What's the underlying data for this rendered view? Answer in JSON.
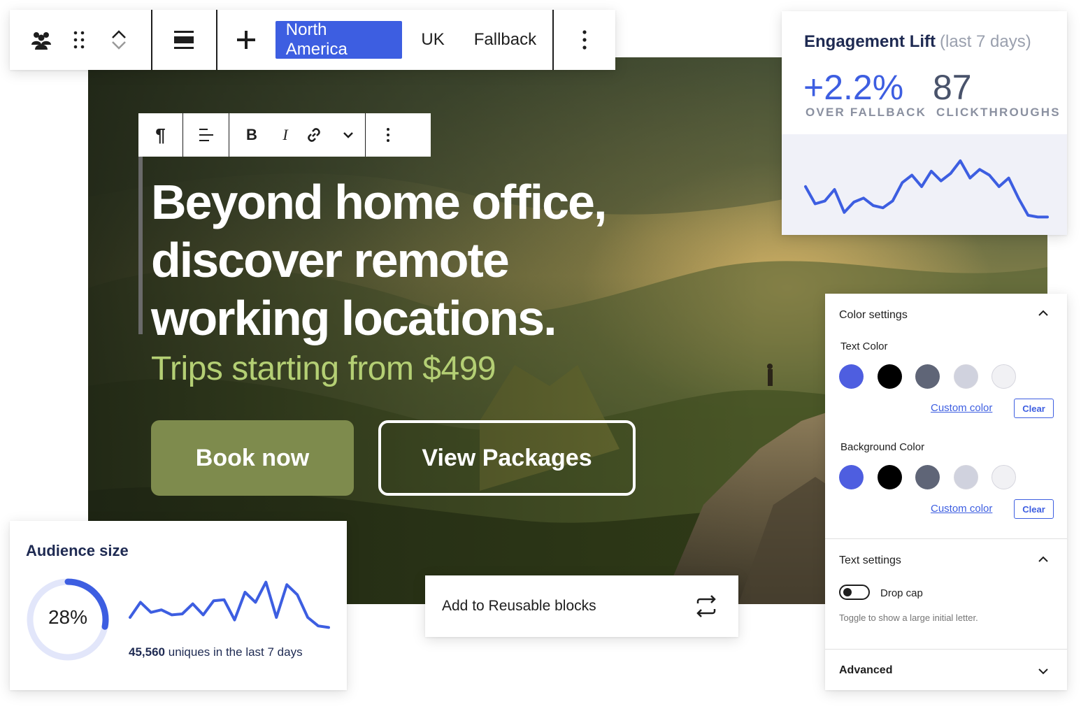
{
  "top_toolbar": {
    "variants": [
      "North America",
      "UK",
      "Fallback"
    ],
    "active_variant": "North America",
    "icons": [
      "group-icon",
      "drag-handle-icon",
      "move-up-icon",
      "move-down-icon",
      "align-icon",
      "add-icon",
      "more-options-icon"
    ]
  },
  "block_toolbar": {
    "icons": [
      "paragraph-icon",
      "text-align-icon",
      "bold-icon",
      "italic-icon",
      "link-icon",
      "chevron-down-icon",
      "more-options-icon"
    ],
    "bold_label": "B",
    "italic_label": "I",
    "paragraph_label": "¶"
  },
  "hero": {
    "headline_lines": [
      "Beyond home office,",
      "discover remote",
      "working locations."
    ],
    "subheadline": "Trips starting from $499",
    "primary_button": "Book now",
    "secondary_button": "View Packages",
    "colors": {
      "primary_button": "#7e8b4d",
      "subheadline": "#b4cf74"
    }
  },
  "engagement": {
    "title": "Engagement Lift",
    "period": "(last 7 days)",
    "lift_value": "+2.2%",
    "lift_label": "OVER FALLBACK",
    "clicks_value": "87",
    "clicks_label": "CLICKTHROUGHS",
    "sparkline": [
      0.55,
      0.25,
      0.3,
      0.5,
      0.1,
      0.28,
      0.35,
      0.22,
      0.18,
      0.3,
      0.62,
      0.75,
      0.55,
      0.82,
      0.65,
      0.78,
      1.0,
      0.7,
      0.85,
      0.75,
      0.55,
      0.7,
      0.35,
      0.05,
      0.02,
      0.02
    ],
    "accent_color": "#3d5ee1"
  },
  "color_settings": {
    "section_title": "Color settings",
    "text_color_label": "Text Color",
    "background_color_label": "Background Color",
    "swatches": [
      "#4e5ee0",
      "#000000",
      "#5f6577",
      "#d0d2de",
      "#f1f1f4"
    ],
    "custom_color_label": "Custom color",
    "clear_label": "Clear"
  },
  "text_settings": {
    "section_title": "Text settings",
    "drop_cap_label": "Drop cap",
    "drop_cap_help": "Toggle to show a large initial letter.",
    "drop_cap_enabled": false
  },
  "advanced": {
    "section_title": "Advanced"
  },
  "audience": {
    "title": "Audience size",
    "percent_label": "28%",
    "percent_value": 0.28,
    "count": "45,560",
    "count_suffix": "uniques in the last 7 days",
    "sparkline": [
      0.25,
      0.55,
      0.35,
      0.4,
      0.3,
      0.32,
      0.52,
      0.3,
      0.58,
      0.6,
      0.2,
      0.75,
      0.55,
      0.95,
      0.25,
      0.9,
      0.7,
      0.25,
      0.08,
      0.05
    ]
  },
  "reusable": {
    "label": "Add to Reusable blocks"
  }
}
